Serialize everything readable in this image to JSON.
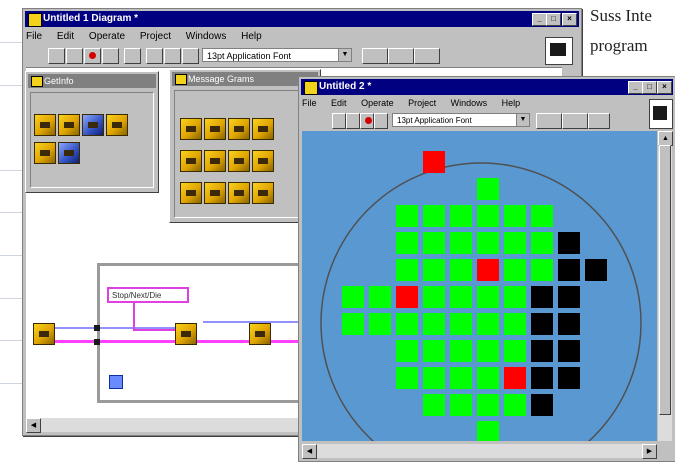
{
  "side_text": [
    "Suss Inte",
    "program"
  ],
  "diagram_window": {
    "title": "Untitled 1 Diagram *",
    "menu": [
      "File",
      "Edit",
      "Operate",
      "Project",
      "Windows",
      "Help"
    ],
    "font_select": "13pt Application Font",
    "palettes": [
      {
        "title": "GetInfo"
      },
      {
        "title": "Message Grams"
      }
    ],
    "string_constant": "Stop/Next/Die"
  },
  "panel_window": {
    "title": "Untitled 2 *",
    "menu": [
      "File",
      "Edit",
      "Operate",
      "Project",
      "Windows",
      "Help"
    ],
    "font_select": "13pt Application Font",
    "wafer": {
      "colors": {
        "pass": "#00ff00",
        "fail": "#ff0000",
        "untested": "#000000",
        "background": "#5a98d2"
      },
      "rows": [
        "...R.....",
        ".....G...",
        "..GGGGGG.",
        "..GGGGGGB",
        "..GGGRGGBB",
        "GGRGGGGBB",
        "GGGGGGGBB",
        "..GGGGGBB",
        "..GGGGRBB",
        "...GGGGB.",
        ".....G...",
        "....GG..."
      ]
    }
  }
}
